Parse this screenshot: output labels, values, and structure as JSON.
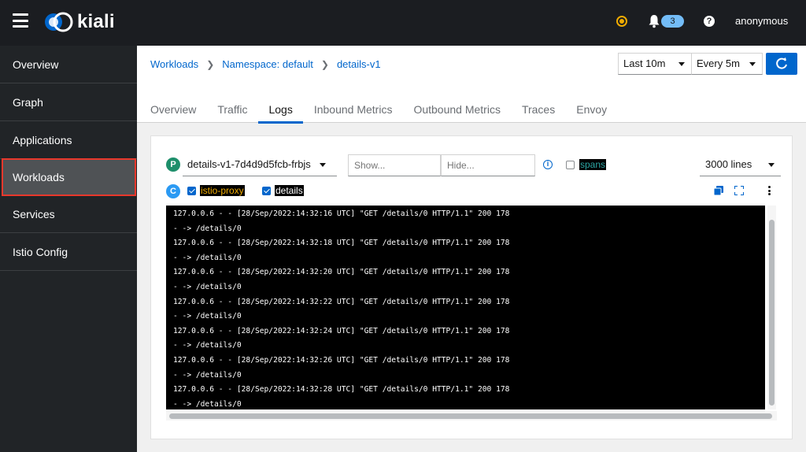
{
  "app": {
    "name": "kiali",
    "user": "anonymous",
    "notification_count": "3",
    "help_glyph": "?"
  },
  "colors": {
    "accent": "#0066cc",
    "nav_bg": "#212427",
    "active_outline": "#e8382c",
    "status_warning": "#f0ab00"
  },
  "sidebar": {
    "items": [
      {
        "label": "Overview"
      },
      {
        "label": "Graph"
      },
      {
        "label": "Applications"
      },
      {
        "label": "Workloads",
        "active": true
      },
      {
        "label": "Services"
      },
      {
        "label": "Istio Config"
      }
    ]
  },
  "breadcrumb": {
    "items": [
      "Workloads",
      "Namespace: default",
      "details-v1"
    ]
  },
  "controls": {
    "time_range": "Last 10m",
    "refresh_interval": "Every 5m"
  },
  "tabs": [
    {
      "label": "Overview"
    },
    {
      "label": "Traffic"
    },
    {
      "label": "Logs",
      "active": true
    },
    {
      "label": "Inbound Metrics"
    },
    {
      "label": "Outbound Metrics"
    },
    {
      "label": "Traces"
    },
    {
      "label": "Envoy"
    }
  ],
  "logs": {
    "pod_badge": "P",
    "container_badge": "C",
    "pod": "details-v1-7d4d9d5fcb-frbjs",
    "show_placeholder": "Show...",
    "hide_placeholder": "Hide...",
    "spans_label": "spans",
    "lines": "3000 lines",
    "containers": [
      {
        "name": "istio-proxy",
        "checked": true
      },
      {
        "name": "details",
        "checked": true
      }
    ],
    "entries": [
      "127.0.0.6 - - [28/Sep/2022:14:32:16 UTC] \"GET /details/0 HTTP/1.1\" 200 178",
      "- -> /details/0",
      "127.0.0.6 - - [28/Sep/2022:14:32:18 UTC] \"GET /details/0 HTTP/1.1\" 200 178",
      "- -> /details/0",
      "127.0.0.6 - - [28/Sep/2022:14:32:20 UTC] \"GET /details/0 HTTP/1.1\" 200 178",
      "- -> /details/0",
      "127.0.0.6 - - [28/Sep/2022:14:32:22 UTC] \"GET /details/0 HTTP/1.1\" 200 178",
      "- -> /details/0",
      "127.0.0.6 - - [28/Sep/2022:14:32:24 UTC] \"GET /details/0 HTTP/1.1\" 200 178",
      "- -> /details/0",
      "127.0.0.6 - - [28/Sep/2022:14:32:26 UTC] \"GET /details/0 HTTP/1.1\" 200 178",
      "- -> /details/0",
      "127.0.0.6 - - [28/Sep/2022:14:32:28 UTC] \"GET /details/0 HTTP/1.1\" 200 178",
      "- -> /details/0"
    ]
  },
  "icons": [
    "menu-icon",
    "kiali-logo-icon",
    "status-warning-icon",
    "bell-icon",
    "help-icon",
    "refresh-icon",
    "info-icon",
    "copy-icon",
    "expand-icon",
    "kebab-icon"
  ]
}
